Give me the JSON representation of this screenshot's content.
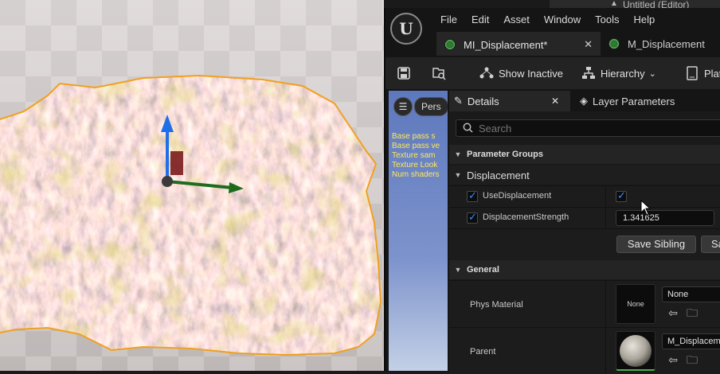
{
  "background_window": {
    "title": "Untitled (Editor)"
  },
  "menu": [
    "File",
    "Edit",
    "Asset",
    "Window",
    "Tools",
    "Help"
  ],
  "tabs": [
    {
      "label": "MI_Displacement*",
      "active": true
    },
    {
      "label": "M_Displacement",
      "active": false
    }
  ],
  "toolbar": {
    "show_inactive": "Show Inactive",
    "hierarchy": "Hierarchy",
    "platforms": "Platf"
  },
  "preview": {
    "perspective_label": "Pers",
    "stats": [
      "Base pass s",
      "Base pass ve",
      "Texture sam",
      "Texture Look",
      "Num shaders"
    ]
  },
  "details_panel": {
    "tabs": {
      "details": "Details",
      "layer_parameters": "Layer Parameters"
    },
    "search_placeholder": "Search",
    "sections": {
      "parameter_groups": "Parameter Groups",
      "displacement": "Displacement",
      "general": "General"
    },
    "params": {
      "use_displacement": {
        "label": "UseDisplacement",
        "override": true,
        "value": true
      },
      "displacement_strength": {
        "label": "DisplacementStrength",
        "override": true,
        "value": "1.341625"
      }
    },
    "buttons": {
      "save_sibling": "Save Sibling",
      "save_child": "Sa"
    },
    "general": {
      "phys_material": {
        "label": "Phys Material",
        "thumb": "None",
        "value": "None"
      },
      "parent": {
        "label": "Parent",
        "value": "M_Displacem"
      }
    }
  },
  "colors": {
    "accent_check": "#3b8cff",
    "selection_outline": "#f0a020",
    "preview_sky": "#6f86c2",
    "stats_text": "#ffe95a"
  }
}
